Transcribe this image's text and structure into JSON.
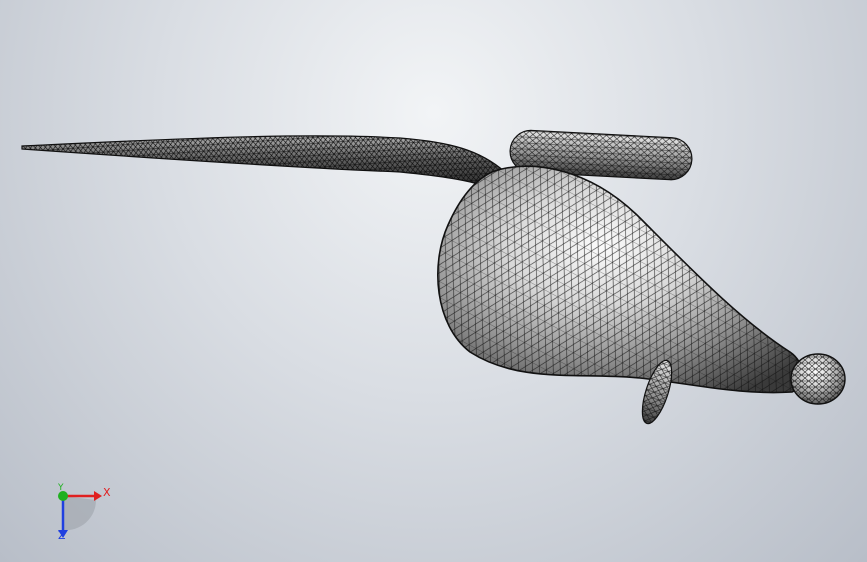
{
  "viewport": {
    "model": "wireframe-mesh-flask",
    "display_style": "wireframe with shaded faces",
    "colors": {
      "background_top": "#f2f4f6",
      "background_bottom": "#b8bec8",
      "mesh_line": "#111111",
      "surface_light": "#ffffff",
      "surface_dark": "#3a3a3a"
    }
  },
  "triad": {
    "x_label": "X",
    "y_label": "Y",
    "z_label": "Z",
    "colors": {
      "x": "#e02020",
      "y": "#20b020",
      "z": "#2040e0"
    }
  }
}
